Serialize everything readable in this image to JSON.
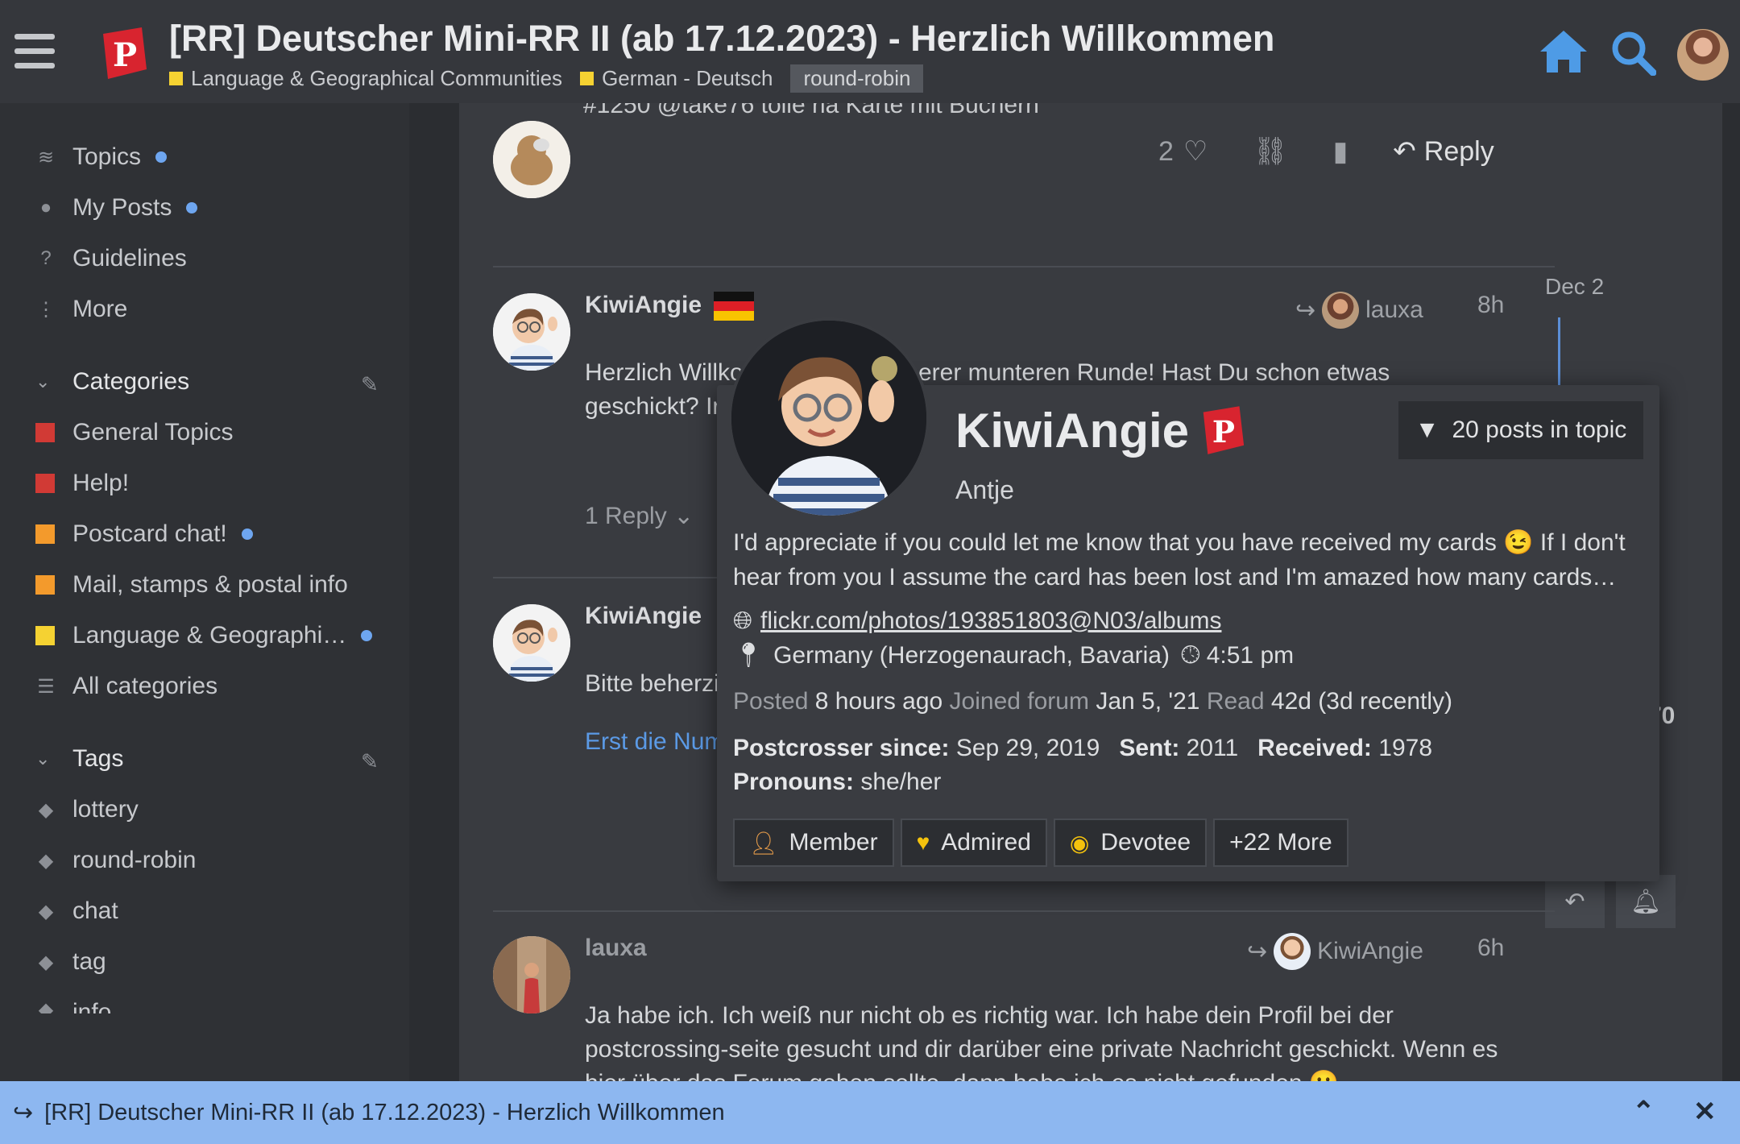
{
  "header": {
    "title": "[RR] Deutscher Mini-RR II (ab 17.12.2023) - Herzlich Willkommen",
    "breadcrumbs": [
      {
        "label": "Language & Geographical Communities",
        "color": "#f5d232"
      },
      {
        "label": "German - Deutsch",
        "color": "#f5d232"
      }
    ],
    "tag": "round-robin"
  },
  "sidebar": {
    "nav": [
      {
        "label": "Topics",
        "icon": "layers-icon",
        "dot": true
      },
      {
        "label": "My Posts",
        "icon": "user-icon",
        "dot": true
      },
      {
        "label": "Guidelines",
        "icon": "question-icon",
        "dot": false
      },
      {
        "label": "More",
        "icon": "vertical-dots-icon",
        "dot": false
      }
    ],
    "categories_label": "Categories",
    "categories": [
      {
        "label": "General Topics",
        "color": "#d13a35",
        "dot": false
      },
      {
        "label": "Help!",
        "color": "#d13a35",
        "dot": false
      },
      {
        "label": "Postcard chat!",
        "color": "#f39a2c",
        "dot": true
      },
      {
        "label": "Mail, stamps & postal info",
        "color": "#f39a2c",
        "dot": false
      },
      {
        "label": "Language & Geographi…",
        "color": "#f5d232",
        "dot": true
      }
    ],
    "all_categories": "All categories",
    "tags_label": "Tags",
    "tags": [
      "lottery",
      "round-robin",
      "chat",
      "tag"
    ],
    "partial_tag": "info"
  },
  "posts": {
    "prev": {
      "cut_text": "#1250  @take76   tolle ria Karte mit Büchern",
      "likes": "2",
      "reply_label": "Reply"
    },
    "post1": {
      "username": "KiwiAngie",
      "reply_to": "lauxa",
      "time": "8h",
      "text_line1": "Herzlich Willko",
      "text_line1_end": "erer munteren Runde! Hast Du schon etwas",
      "text_line2": "geschickt? Ir",
      "replies": "1 Reply"
    },
    "post2": {
      "username": "KiwiAngie",
      "text": "Bitte beherzi",
      "link": "Erst die Num",
      "partial_number": "70"
    },
    "post3": {
      "username": "lauxa",
      "reply_to": "KiwiAngie",
      "time": "6h",
      "text_line1": "Ja habe ich. Ich weiß nur nicht ob es richtig war. Ich habe dein Profil bei der",
      "text_line2": "postcrossing-seite gesucht und dir darüber eine private Nachricht geschickt. Wenn es",
      "text_line3": "hier über das Forum gehen sollte, dann habe ich es nicht gefunden 🙂"
    }
  },
  "timeline": {
    "date": "Dec 2"
  },
  "user_card": {
    "username": "KiwiAngie",
    "full_name": "Antje",
    "filter_label": "20 posts in topic",
    "bio_line1": "I'd appreciate if you could let me know that you have received my cards 😉 If I don't",
    "bio_line2": "hear from you I assume the card has been lost and I'm amazed how many cards…",
    "website": "flickr.com/photos/193851803@N03/albums",
    "location": "Germany (Herzogenaurach, Bavaria)",
    "local_time": "4:51 pm",
    "posted_label": "Posted",
    "posted_value": "8 hours ago",
    "joined_label": "Joined forum",
    "joined_value": "Jan 5, '21",
    "read_label": "Read",
    "read_value": "42d (3d recently)",
    "since_label": "Postcrosser since:",
    "since_value": "Sep 29, 2019",
    "sent_label": "Sent:",
    "sent_value": "2011",
    "received_label": "Received:",
    "received_value": "1978",
    "pronouns_label": "Pronouns:",
    "pronouns_value": "she/her",
    "badges": [
      {
        "label": "Member",
        "icon": "person-icon"
      },
      {
        "label": "Admired",
        "icon": "heart-icon"
      },
      {
        "label": "Devotee",
        "icon": "eye-icon"
      },
      {
        "label": "+22 More",
        "icon": ""
      }
    ]
  },
  "bottom_bar": {
    "title": "[RR] Deutscher Mini-RR II (ab 17.12.2023) - Herzlich Willkommen"
  },
  "colors": {
    "accent": "#4a90d9",
    "bottom_bar": "#8db7f0",
    "logo_red": "#d8242f"
  }
}
